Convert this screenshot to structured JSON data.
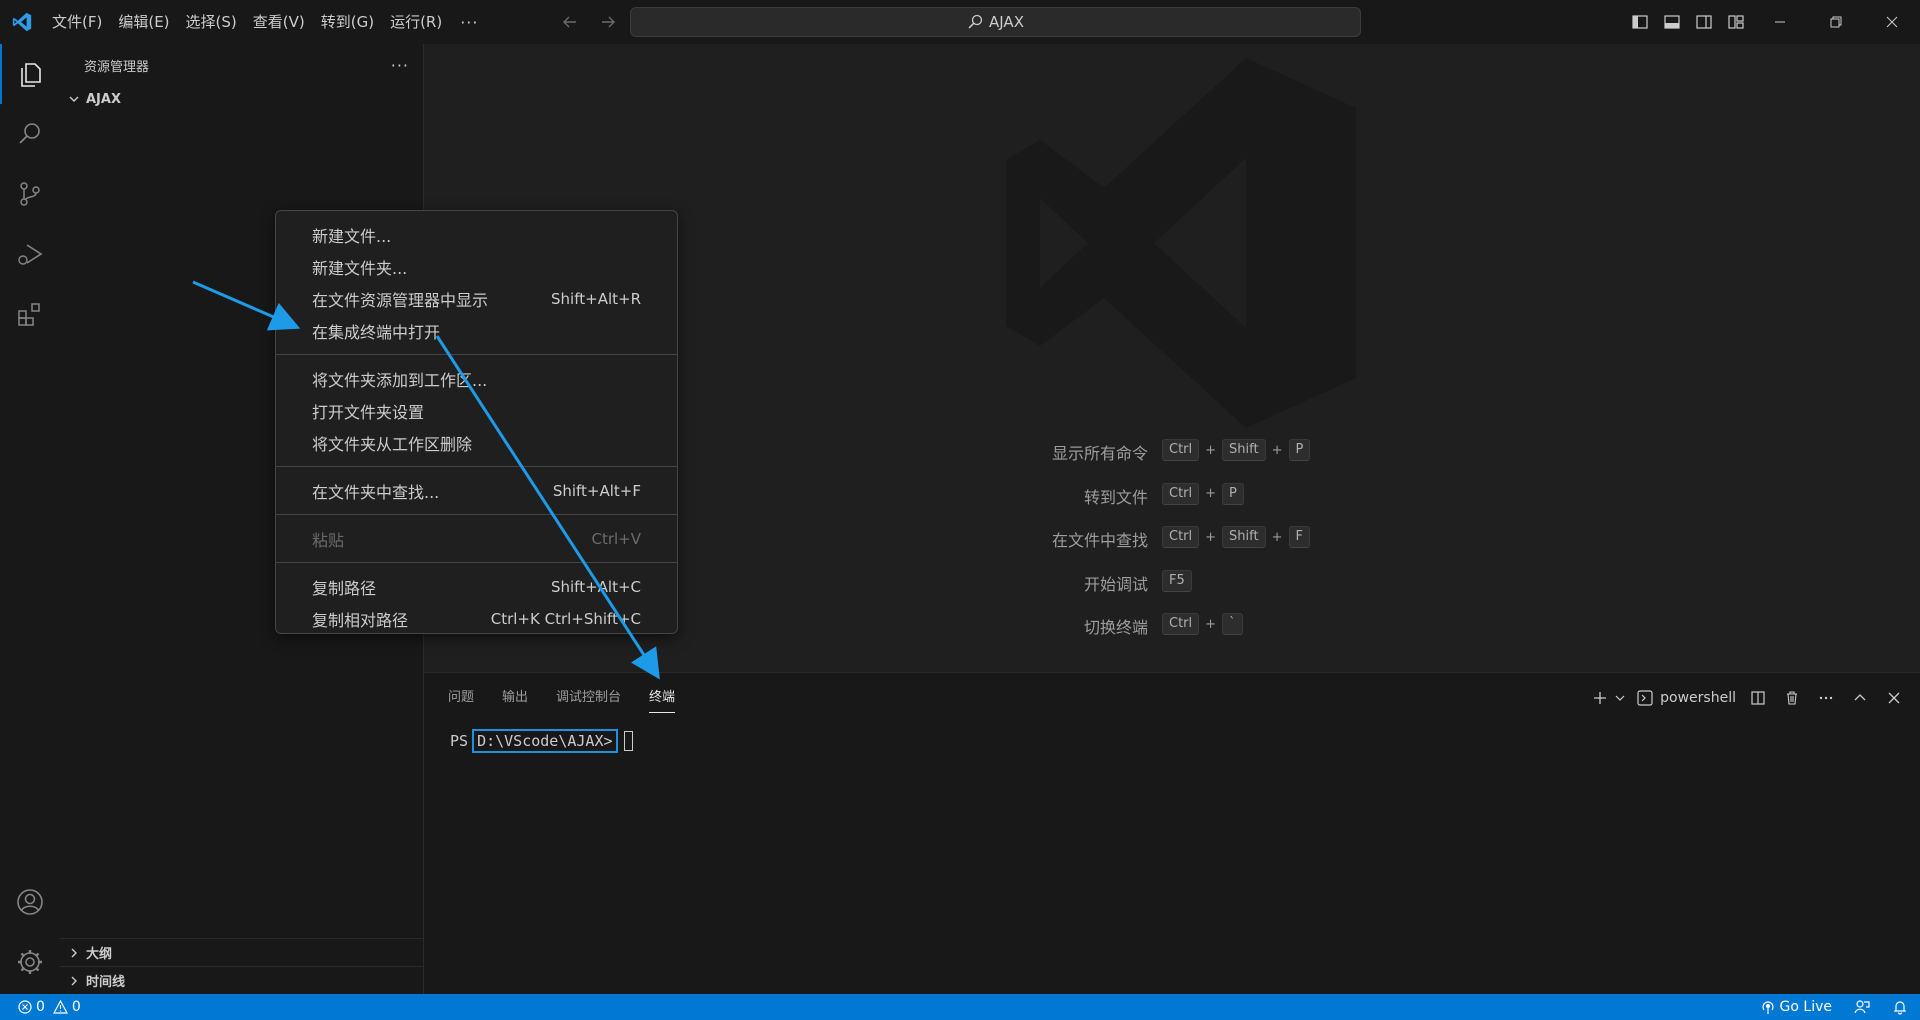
{
  "titlebar": {
    "menus": [
      "文件(F)",
      "编辑(E)",
      "选择(S)",
      "查看(V)",
      "转到(G)",
      "运行(R)"
    ],
    "more": "···",
    "search": "AJAX"
  },
  "sidebar": {
    "title": "资源管理器",
    "more": "···",
    "folder": "AJAX",
    "sections": [
      "大纲",
      "时间线"
    ]
  },
  "context_menu": {
    "groups": [
      [
        {
          "label": "新建文件...",
          "key": ""
        },
        {
          "label": "新建文件夹...",
          "key": ""
        },
        {
          "label": "在文件资源管理器中显示",
          "key": "Shift+Alt+R"
        },
        {
          "label": "在集成终端中打开",
          "key": ""
        }
      ],
      [
        {
          "label": "将文件夹添加到工作区...",
          "key": ""
        },
        {
          "label": "打开文件夹设置",
          "key": ""
        },
        {
          "label": "将文件夹从工作区删除",
          "key": ""
        }
      ],
      [
        {
          "label": "在文件夹中查找...",
          "key": "Shift+Alt+F"
        }
      ],
      [
        {
          "label": "粘贴",
          "key": "Ctrl+V",
          "disabled": true
        }
      ],
      [
        {
          "label": "复制路径",
          "key": "Shift+Alt+C"
        },
        {
          "label": "复制相对路径",
          "key": "Ctrl+K Ctrl+Shift+C"
        }
      ]
    ]
  },
  "shortcuts": [
    {
      "label": "显示所有命令",
      "keys": [
        "Ctrl",
        "Shift",
        "P"
      ]
    },
    {
      "label": "转到文件",
      "keys": [
        "Ctrl",
        "P"
      ]
    },
    {
      "label": "在文件中查找",
      "keys": [
        "Ctrl",
        "Shift",
        "F"
      ]
    },
    {
      "label": "开始调试",
      "keys": [
        "F5"
      ]
    },
    {
      "label": "切换终端",
      "keys": [
        "Ctrl",
        "`"
      ]
    }
  ],
  "panel": {
    "tabs": [
      "问题",
      "输出",
      "调试控制台",
      "终端"
    ],
    "active_tab": "终端",
    "profile": "powershell",
    "terminal_prefix": "PS",
    "terminal_path": "D:\\VScode\\AJAX>"
  },
  "statusbar": {
    "errors": "0",
    "warnings": "0",
    "golive": "Go Live"
  },
  "colors": {
    "accent": "#0078d4",
    "annotation": "#1e9be8"
  }
}
